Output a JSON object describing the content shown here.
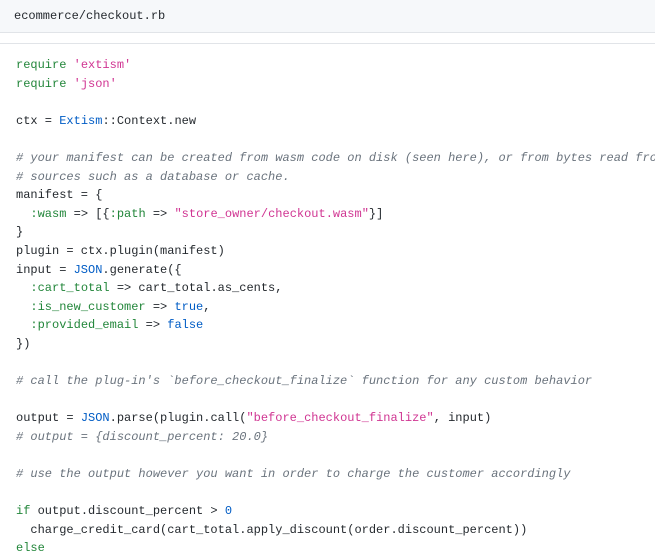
{
  "file": {
    "path": "ecommerce/checkout.rb"
  },
  "code": {
    "l1_require": "require",
    "l1_extism": "'extism'",
    "l2_require": "require",
    "l2_json": "'json'",
    "l4": "ctx = Extism::Context.new",
    "l4_const": "Extism",
    "l4_pre": "ctx = ",
    "l4_post": "::Context.new",
    "c1": "# your manifest can be created from wasm code on disk (seen here), or from bytes read from other",
    "c2": "# sources such as a database or cache.",
    "l7": "manifest = {",
    "l8_sym": ":wasm",
    "l8_mid": " => [{",
    "l8_sym2": ":path",
    "l8_mid2": " => ",
    "l8_str": "\"store_owner/checkout.wasm\"",
    "l8_end": "}]",
    "l9": "}",
    "l10": "plugin = ctx.plugin(manifest)",
    "l11_pre": "input = ",
    "l11_const": "JSON",
    "l11_post": ".generate({",
    "l12_sym": ":cart_total",
    "l12_rest": " => cart_total.as_cents,",
    "l13_sym": ":is_new_customer",
    "l13_mid": " => ",
    "l13_bool": "true",
    "l13_end": ",",
    "l14_sym": ":provided_email",
    "l14_mid": " => ",
    "l14_bool": "false",
    "l15": "})",
    "c3": "# call the plug-in's `before_checkout_finalize` function for any custom behavior",
    "l18_pre": "output = ",
    "l18_const": "JSON",
    "l18_mid": ".parse(plugin.call(",
    "l18_str": "\"before_checkout_finalize\"",
    "l18_end": ", input)",
    "c4": "# output = {discount_percent: 20.0}",
    "c5": "# use the output however you want in order to charge the customer accordingly",
    "l22_if": "if",
    "l22_mid": " output.discount_percent > ",
    "l22_num": "0",
    "l23": "  charge_credit_card(cart_total.apply_discount(order.discount_percent))",
    "l24_else": "else"
  }
}
